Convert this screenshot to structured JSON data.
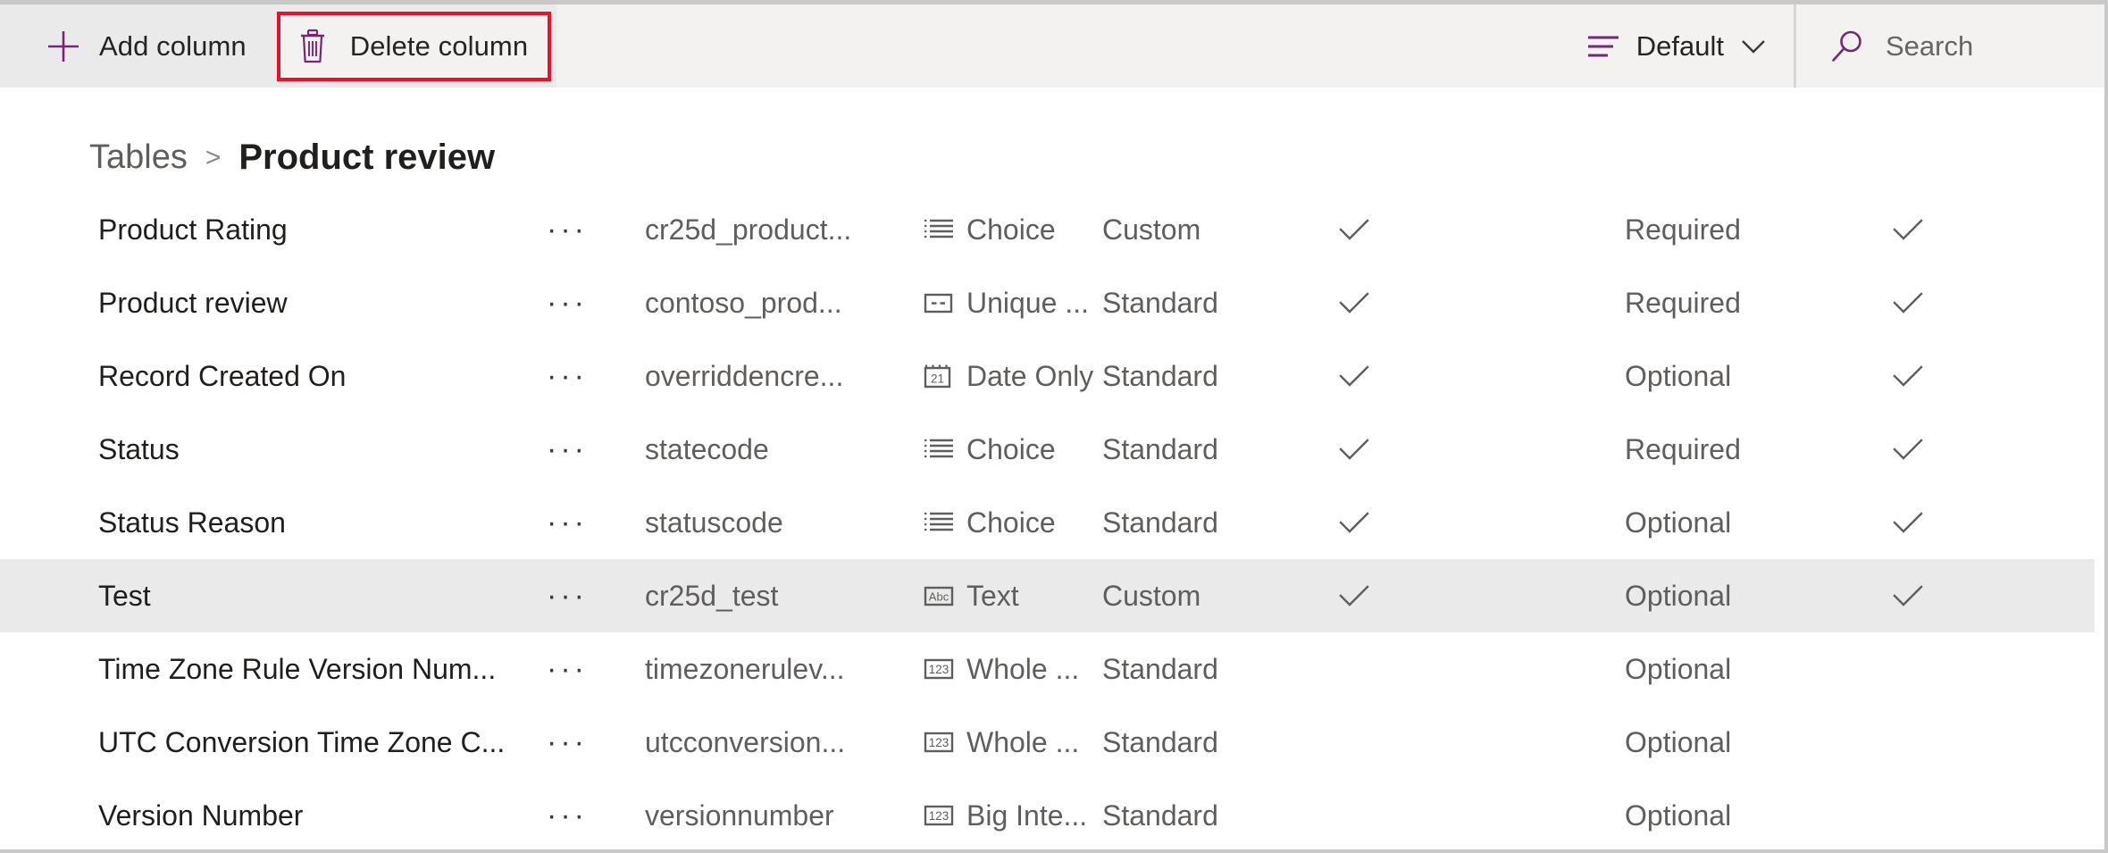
{
  "toolbar": {
    "add_column_label": "Add column",
    "delete_column_label": "Delete column",
    "view_label": "Default",
    "search_placeholder": "Search",
    "highlight_color": "#e8112d",
    "accent_color": "#742774"
  },
  "breadcrumb": {
    "parent": "Tables",
    "separator": ">",
    "current": "Product review"
  },
  "grid": {
    "row_menu_glyph": "···",
    "rows": [
      {
        "display_name": "Product Rating",
        "logical_name": "cr25d_product...",
        "data_type": "Choice",
        "type_icon": "choice-list-icon",
        "source": "Custom",
        "customizable": true,
        "requirement": "Required",
        "searchable": true
      },
      {
        "display_name": "Product review",
        "logical_name": "contoso_prod...",
        "data_type": "Unique ...",
        "type_icon": "unique-identifier-icon",
        "source": "Standard",
        "customizable": true,
        "requirement": "Required",
        "searchable": true
      },
      {
        "display_name": "Record Created On",
        "logical_name": "overriddencre...",
        "data_type": "Date Only",
        "type_icon": "calendar-21-icon",
        "source": "Standard",
        "customizable": true,
        "requirement": "Optional",
        "searchable": true
      },
      {
        "display_name": "Status",
        "logical_name": "statecode",
        "data_type": "Choice",
        "type_icon": "choice-list-icon",
        "source": "Standard",
        "customizable": true,
        "requirement": "Required",
        "searchable": true
      },
      {
        "display_name": "Status Reason",
        "logical_name": "statuscode",
        "data_type": "Choice",
        "type_icon": "choice-list-icon",
        "source": "Standard",
        "customizable": true,
        "requirement": "Optional",
        "searchable": true
      },
      {
        "display_name": "Test",
        "logical_name": "cr25d_test",
        "data_type": "Text",
        "type_icon": "abc-text-icon",
        "source": "Custom",
        "customizable": true,
        "requirement": "Optional",
        "searchable": true,
        "selected": true
      },
      {
        "display_name": "Time Zone Rule Version Num...",
        "logical_name": "timezonerulev...",
        "data_type": "Whole ...",
        "type_icon": "number-123-icon",
        "source": "Standard",
        "customizable": false,
        "requirement": "Optional",
        "searchable": false
      },
      {
        "display_name": "UTC Conversion Time Zone C...",
        "logical_name": "utcconversion...",
        "data_type": "Whole ...",
        "type_icon": "number-123-icon",
        "source": "Standard",
        "customizable": false,
        "requirement": "Optional",
        "searchable": false
      },
      {
        "display_name": "Version Number",
        "logical_name": "versionnumber",
        "data_type": "Big Inte...",
        "type_icon": "number-123-icon",
        "source": "Standard",
        "customizable": false,
        "requirement": "Optional",
        "searchable": false
      }
    ]
  }
}
